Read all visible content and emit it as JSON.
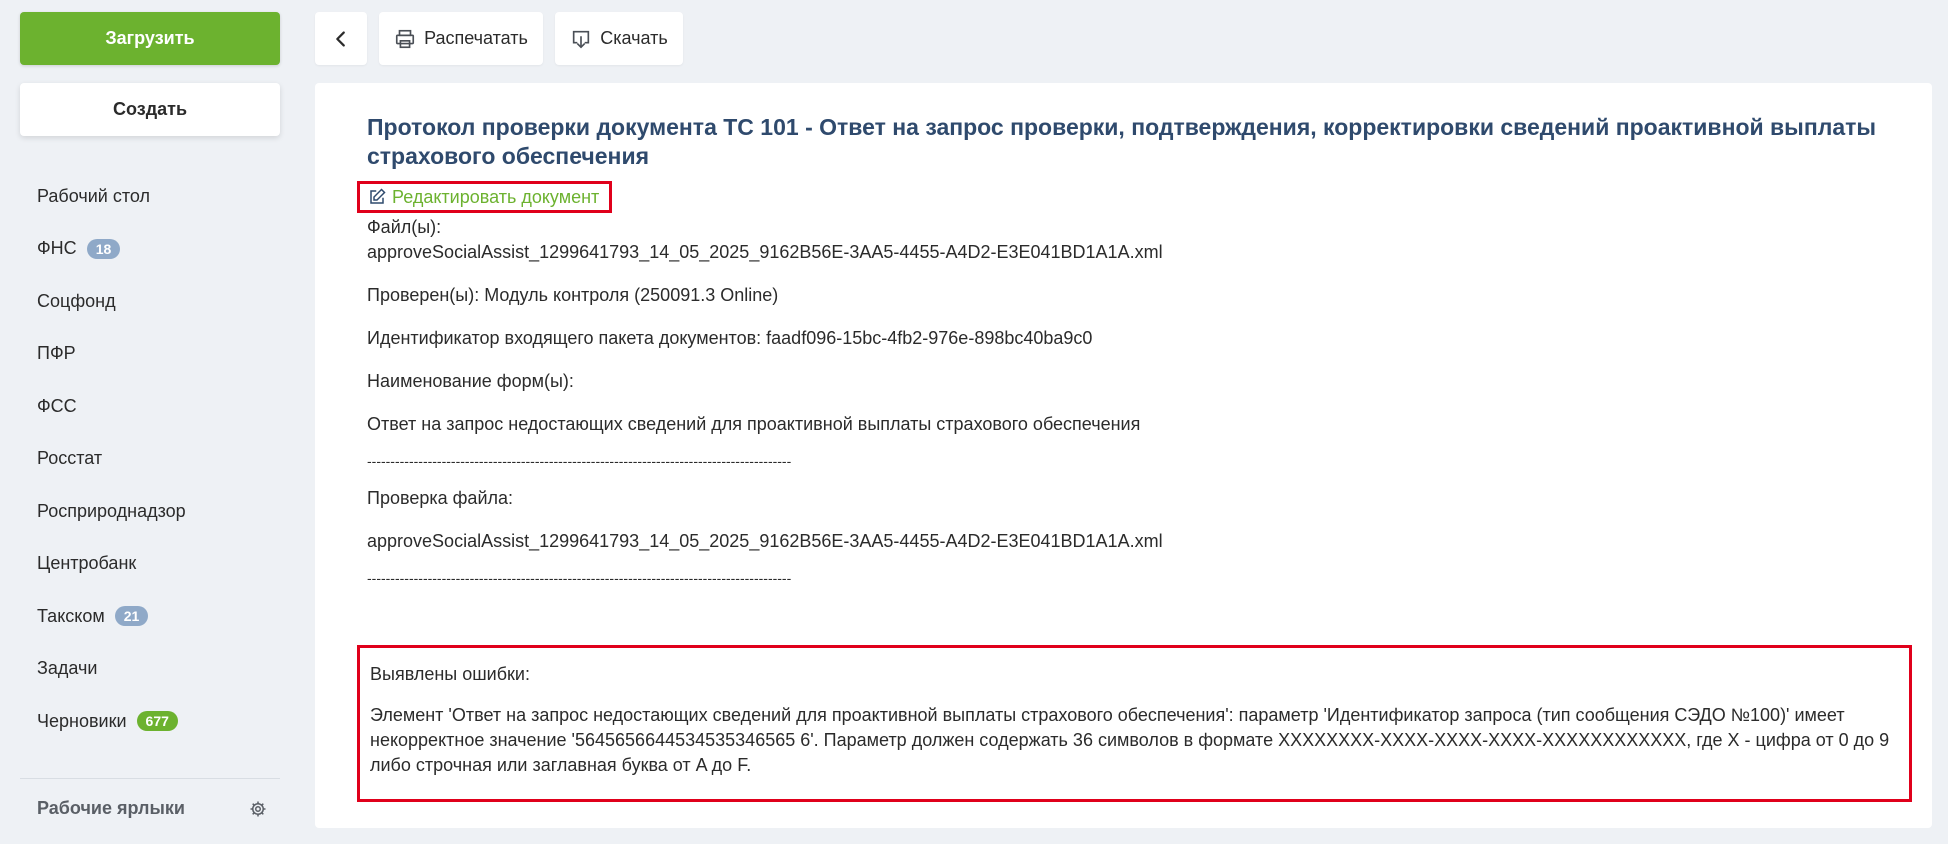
{
  "sidebar": {
    "upload_label": "Загрузить",
    "create_label": "Создать",
    "items": [
      {
        "label": "Рабочий стол",
        "badge": null
      },
      {
        "label": "ФНС",
        "badge": "18",
        "badge_color": "#8fa9c8"
      },
      {
        "label": "Соцфонд",
        "badge": null
      },
      {
        "label": "ПФР",
        "badge": null
      },
      {
        "label": "ФСС",
        "badge": null
      },
      {
        "label": "Росстат",
        "badge": null
      },
      {
        "label": "Росприроднадзор",
        "badge": null
      },
      {
        "label": "Центробанк",
        "badge": null
      },
      {
        "label": "Такском",
        "badge": "21",
        "badge_color": "#8fa9c8"
      },
      {
        "label": "Задачи",
        "badge": null
      },
      {
        "label": "Черновики",
        "badge": "677",
        "badge_color": "#6cb22f"
      }
    ],
    "shortcuts_label": "Рабочие ярлыки",
    "shortcuts_icon": "gear-icon"
  },
  "toolbar": {
    "back_icon": "chevron-left-icon",
    "print_label": "Распечатать",
    "print_icon": "printer-icon",
    "download_label": "Скачать",
    "download_icon": "download-icon"
  },
  "document": {
    "title": "Протокол проверки документа ТС 101 - Ответ на запрос проверки, подтверждения, корректировки сведений проактивной выплаты страхового обеспечения",
    "edit_label": "Редактировать документ",
    "edit_icon": "edit-icon",
    "files_label": "Файл(ы):",
    "file_name": "approveSocialAssist_1299641793_14_05_2025_9162B56E-3AA5-4455-A4D2-E3E041BD1A1A.xml",
    "checked_by": "Проверен(ы): Модуль контроля (250091.3 Online)",
    "package_id": "Идентификатор входящего пакета документов: faadf096-15bc-4fb2-976e-898bc40ba9c0",
    "forms_label": "Наименование форм(ы):",
    "form_name": "Ответ на запрос недостающих сведений для проактивной выплаты страхового обеспечения",
    "separator": "-------------------------------------------------------------------------------------------",
    "file_check_label": "Проверка файла:",
    "file_check_name": "approveSocialAssist_1299641793_14_05_2025_9162B56E-3AA5-4455-A4D2-E3E041BD1A1A.xml",
    "errors_label": "Выявлены ошибки:",
    "error_text": "Элемент 'Ответ на запрос недостающих сведений для проактивной выплаты страхового обеспечения': параметр 'Идентификатор запроса (тип сообщения СЭДО №100)' имеет некорректное значение '5645656644534535346565 6'. Параметр должен содержать 36 символов в формате XXXXXXXX-XXXX-XXXX-XXXX-XXXXXXXXXXXX, где X - цифра от 0 до 9 либо строчная или заглавная буква от A до F."
  },
  "colors": {
    "accent_green": "#6cb22f",
    "title_blue": "#2f4a6d",
    "highlight_red": "#e0001b",
    "badge_blue": "#8fa9c8"
  }
}
